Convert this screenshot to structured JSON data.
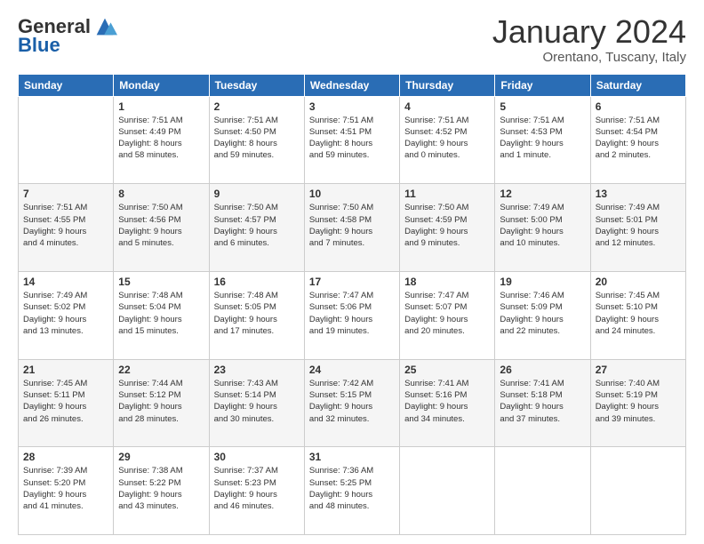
{
  "logo": {
    "general": "General",
    "blue": "Blue"
  },
  "header": {
    "title": "January 2024",
    "subtitle": "Orentano, Tuscany, Italy"
  },
  "weekdays": [
    "Sunday",
    "Monday",
    "Tuesday",
    "Wednesday",
    "Thursday",
    "Friday",
    "Saturday"
  ],
  "weeks": [
    [
      {
        "day": "",
        "info": ""
      },
      {
        "day": "1",
        "info": "Sunrise: 7:51 AM\nSunset: 4:49 PM\nDaylight: 8 hours\nand 58 minutes."
      },
      {
        "day": "2",
        "info": "Sunrise: 7:51 AM\nSunset: 4:50 PM\nDaylight: 8 hours\nand 59 minutes."
      },
      {
        "day": "3",
        "info": "Sunrise: 7:51 AM\nSunset: 4:51 PM\nDaylight: 8 hours\nand 59 minutes."
      },
      {
        "day": "4",
        "info": "Sunrise: 7:51 AM\nSunset: 4:52 PM\nDaylight: 9 hours\nand 0 minutes."
      },
      {
        "day": "5",
        "info": "Sunrise: 7:51 AM\nSunset: 4:53 PM\nDaylight: 9 hours\nand 1 minute."
      },
      {
        "day": "6",
        "info": "Sunrise: 7:51 AM\nSunset: 4:54 PM\nDaylight: 9 hours\nand 2 minutes."
      }
    ],
    [
      {
        "day": "7",
        "info": "Sunrise: 7:51 AM\nSunset: 4:55 PM\nDaylight: 9 hours\nand 4 minutes."
      },
      {
        "day": "8",
        "info": "Sunrise: 7:50 AM\nSunset: 4:56 PM\nDaylight: 9 hours\nand 5 minutes."
      },
      {
        "day": "9",
        "info": "Sunrise: 7:50 AM\nSunset: 4:57 PM\nDaylight: 9 hours\nand 6 minutes."
      },
      {
        "day": "10",
        "info": "Sunrise: 7:50 AM\nSunset: 4:58 PM\nDaylight: 9 hours\nand 7 minutes."
      },
      {
        "day": "11",
        "info": "Sunrise: 7:50 AM\nSunset: 4:59 PM\nDaylight: 9 hours\nand 9 minutes."
      },
      {
        "day": "12",
        "info": "Sunrise: 7:49 AM\nSunset: 5:00 PM\nDaylight: 9 hours\nand 10 minutes."
      },
      {
        "day": "13",
        "info": "Sunrise: 7:49 AM\nSunset: 5:01 PM\nDaylight: 9 hours\nand 12 minutes."
      }
    ],
    [
      {
        "day": "14",
        "info": "Sunrise: 7:49 AM\nSunset: 5:02 PM\nDaylight: 9 hours\nand 13 minutes."
      },
      {
        "day": "15",
        "info": "Sunrise: 7:48 AM\nSunset: 5:04 PM\nDaylight: 9 hours\nand 15 minutes."
      },
      {
        "day": "16",
        "info": "Sunrise: 7:48 AM\nSunset: 5:05 PM\nDaylight: 9 hours\nand 17 minutes."
      },
      {
        "day": "17",
        "info": "Sunrise: 7:47 AM\nSunset: 5:06 PM\nDaylight: 9 hours\nand 19 minutes."
      },
      {
        "day": "18",
        "info": "Sunrise: 7:47 AM\nSunset: 5:07 PM\nDaylight: 9 hours\nand 20 minutes."
      },
      {
        "day": "19",
        "info": "Sunrise: 7:46 AM\nSunset: 5:09 PM\nDaylight: 9 hours\nand 22 minutes."
      },
      {
        "day": "20",
        "info": "Sunrise: 7:45 AM\nSunset: 5:10 PM\nDaylight: 9 hours\nand 24 minutes."
      }
    ],
    [
      {
        "day": "21",
        "info": "Sunrise: 7:45 AM\nSunset: 5:11 PM\nDaylight: 9 hours\nand 26 minutes."
      },
      {
        "day": "22",
        "info": "Sunrise: 7:44 AM\nSunset: 5:12 PM\nDaylight: 9 hours\nand 28 minutes."
      },
      {
        "day": "23",
        "info": "Sunrise: 7:43 AM\nSunset: 5:14 PM\nDaylight: 9 hours\nand 30 minutes."
      },
      {
        "day": "24",
        "info": "Sunrise: 7:42 AM\nSunset: 5:15 PM\nDaylight: 9 hours\nand 32 minutes."
      },
      {
        "day": "25",
        "info": "Sunrise: 7:41 AM\nSunset: 5:16 PM\nDaylight: 9 hours\nand 34 minutes."
      },
      {
        "day": "26",
        "info": "Sunrise: 7:41 AM\nSunset: 5:18 PM\nDaylight: 9 hours\nand 37 minutes."
      },
      {
        "day": "27",
        "info": "Sunrise: 7:40 AM\nSunset: 5:19 PM\nDaylight: 9 hours\nand 39 minutes."
      }
    ],
    [
      {
        "day": "28",
        "info": "Sunrise: 7:39 AM\nSunset: 5:20 PM\nDaylight: 9 hours\nand 41 minutes."
      },
      {
        "day": "29",
        "info": "Sunrise: 7:38 AM\nSunset: 5:22 PM\nDaylight: 9 hours\nand 43 minutes."
      },
      {
        "day": "30",
        "info": "Sunrise: 7:37 AM\nSunset: 5:23 PM\nDaylight: 9 hours\nand 46 minutes."
      },
      {
        "day": "31",
        "info": "Sunrise: 7:36 AM\nSunset: 5:25 PM\nDaylight: 9 hours\nand 48 minutes."
      },
      {
        "day": "",
        "info": ""
      },
      {
        "day": "",
        "info": ""
      },
      {
        "day": "",
        "info": ""
      }
    ]
  ]
}
